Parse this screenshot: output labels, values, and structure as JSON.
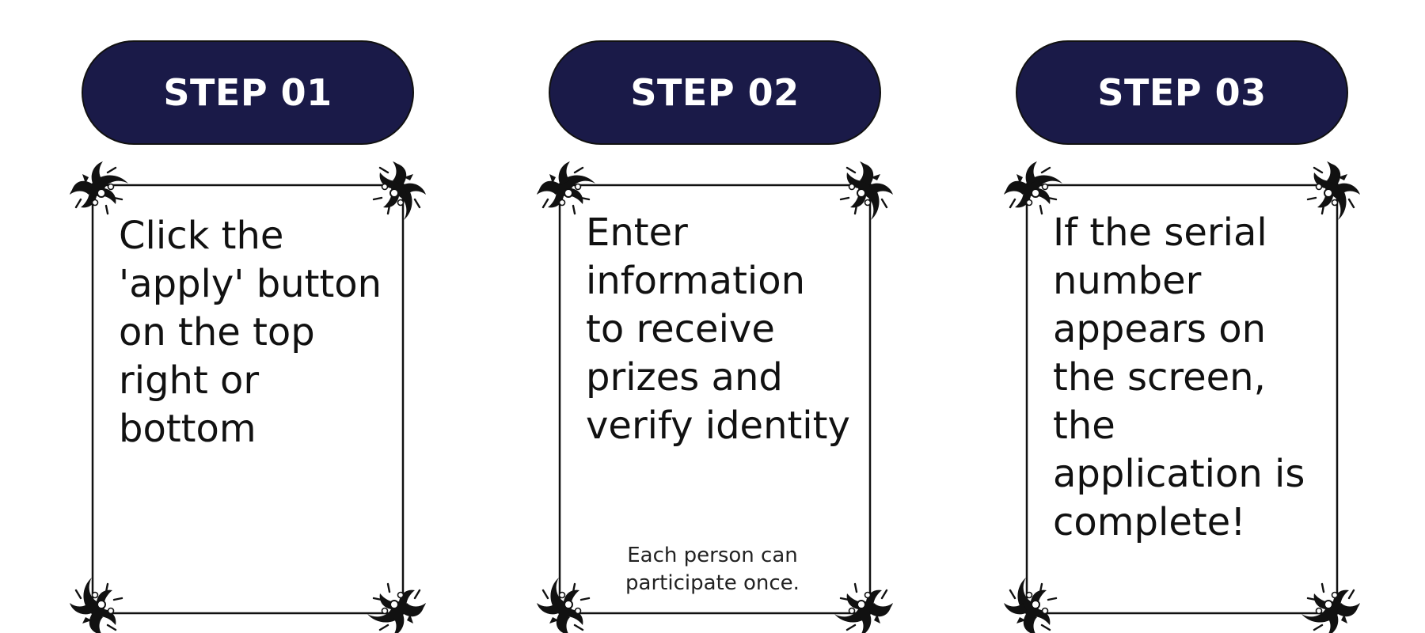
{
  "colors": {
    "pill_background": "#1a1a48",
    "pill_text": "#ffffff",
    "frame": "#111111"
  },
  "steps": [
    {
      "label": "STEP 01",
      "text": "Click the 'apply' button on the top right or bottom",
      "note": ""
    },
    {
      "label": "STEP 02",
      "text": "Enter information to receive prizes and verify identity",
      "note": "Each person can participate once."
    },
    {
      "label": "STEP 03",
      "text": "If the serial number appears on the screen, the application is complete!",
      "note": ""
    }
  ]
}
